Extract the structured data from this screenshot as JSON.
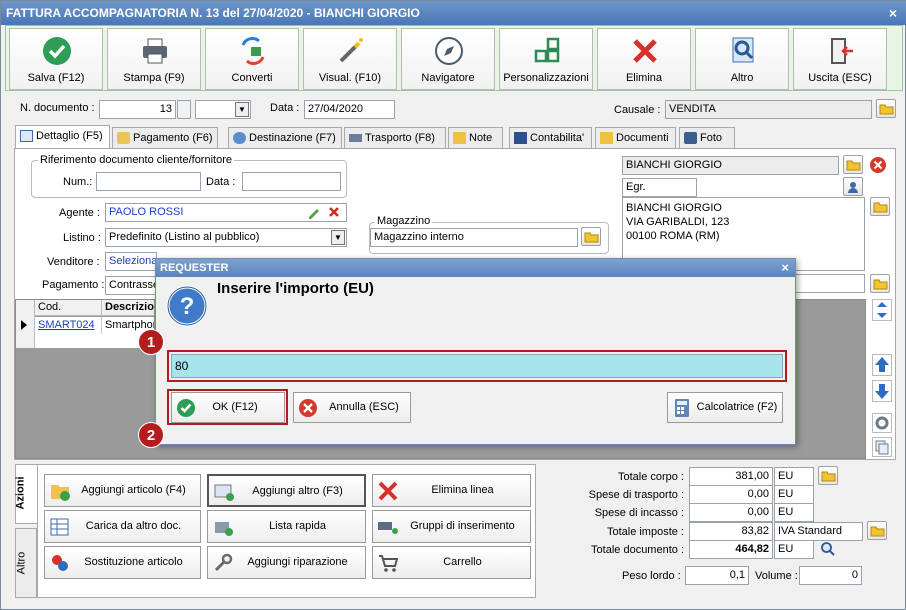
{
  "window": {
    "title": "FATTURA ACCOMPAGNATORIA N. 13 del 27/04/2020 - BIANCHI GIORGIO",
    "close": "×"
  },
  "toolbar": [
    {
      "label": "Salva (F12)",
      "icon": "check-icon"
    },
    {
      "label": "Stampa (F9)",
      "icon": "printer-icon"
    },
    {
      "label": "Converti",
      "icon": "convert-icon"
    },
    {
      "label": "Visual. (F10)",
      "icon": "magic-wand-icon"
    },
    {
      "label": "Navigatore",
      "icon": "compass-icon"
    },
    {
      "label": "Personalizzazioni",
      "icon": "grid-icon"
    },
    {
      "label": "Elimina",
      "icon": "x-icon"
    },
    {
      "label": "Altro",
      "icon": "magnifier-icon"
    },
    {
      "label": "Uscita (ESC)",
      "icon": "exit-door-icon"
    }
  ],
  "header": {
    "doc_label": "N. documento :",
    "doc_value": "13",
    "date_label": "Data :",
    "date_value": "27/04/2020",
    "causale_label": "Causale :",
    "causale_value": "VENDITA"
  },
  "tabs": [
    "Dettaglio (F5)",
    "Pagamento (F6)",
    "Destinazione (F7)",
    "Trasporto (F8)",
    "Note",
    "Contabilita'",
    "Documenti",
    "Foto"
  ],
  "detail": {
    "rif_title": "Riferimento documento cliente/fornitore",
    "num_label": "Num.:",
    "num_value": "",
    "data_label": "Data :",
    "data_value": "",
    "agente_label": "Agente :",
    "agente_value": "PAOLO ROSSI",
    "listino_label": "Listino :",
    "listino_value": "Predefinito (Listino al pubblico)",
    "venditore_label": "Venditore :",
    "venditore_value": "Seleziona",
    "pagamento_label": "Pagamento :",
    "pagamento_value": "Contrasse",
    "magazzino_title": "Magazzino",
    "magazzino_value": "Magazzino interno",
    "cliente_name": "BIANCHI GIORGIO",
    "cliente_title": "Egr.",
    "address": [
      "BIANCHI GIORGIO",
      "VIA GARIBALDI, 123",
      "00100 ROMA (RM)"
    ]
  },
  "grid": {
    "headers": [
      "Cod.",
      "Descrizio"
    ],
    "rows": [
      {
        "cod": "SMART024",
        "desc": "Smartphon"
      }
    ]
  },
  "side_tabs": [
    "Azioni",
    "Altro"
  ],
  "actions": [
    "Aggiungi articolo (F4)",
    "Aggiungi altro (F3)",
    "Elimina linea",
    "Carica da altro doc.",
    "Lista rapida",
    "Gruppi di inserimento",
    "Sostituzione articolo",
    "Aggiungi riparazione",
    "Carrello"
  ],
  "totals": {
    "totale_corpo_label": "Totale corpo :",
    "totale_corpo": "381,00",
    "spese_trasporto_label": "Spese di trasporto :",
    "spese_trasporto": "0,00",
    "spese_incasso_label": "Spese di incasso :",
    "spese_incasso": "0,00",
    "totale_imposte_label": "Totale imposte :",
    "totale_imposte": "83,82",
    "iva": "IVA Standard",
    "totale_documento_label": "Totale documento :",
    "totale_documento": "464,82",
    "currency": "EU",
    "peso_label": "Peso lordo :",
    "peso": "0,1",
    "volume_label": "Volume :",
    "volume": "0"
  },
  "dialog": {
    "title": "REQUESTER",
    "close": "×",
    "prompt": "Inserire l'importo (EU)",
    "value": "80",
    "ok": "OK (F12)",
    "cancel": "Annulla (ESC)",
    "calc": "Calcolatrice (F2)",
    "badge1": "1",
    "badge2": "2"
  },
  "colors": {
    "accent": "#5A84BF",
    "toolbar_bg": "#E8F4E4",
    "highlight_red": "#B01C1C",
    "input_cyan": "#A8E4EE"
  }
}
